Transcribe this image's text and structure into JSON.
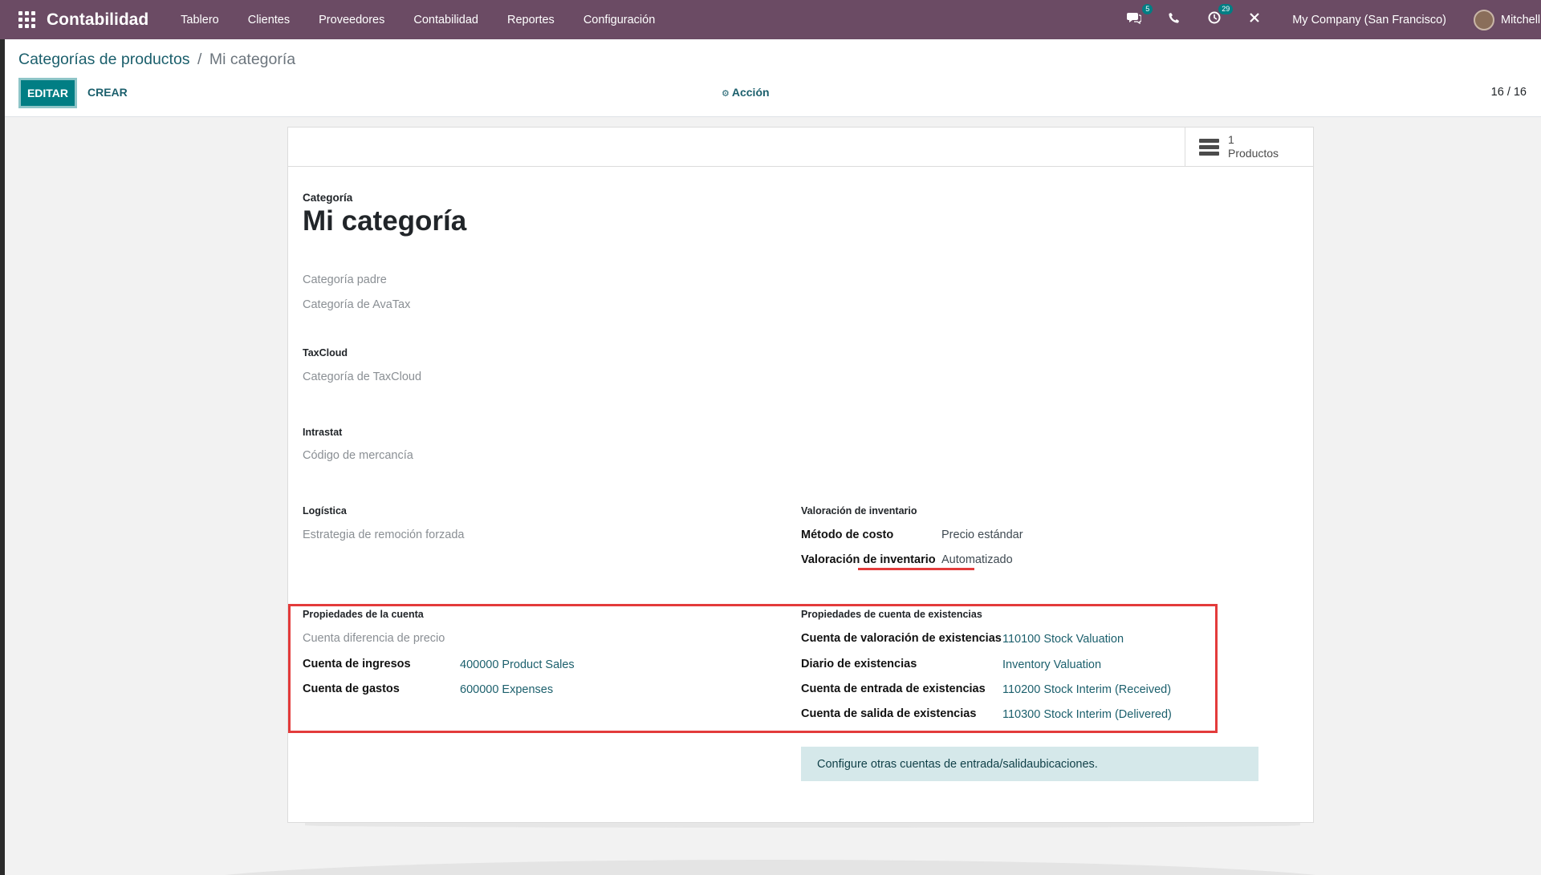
{
  "navbar": {
    "app_name": "Contabilidad",
    "menu": [
      "Tablero",
      "Clientes",
      "Proveedores",
      "Contabilidad",
      "Reportes",
      "Configuración"
    ],
    "messages_badge": "5",
    "activity_badge": "29",
    "company": "My Company (San Francisco)",
    "user": "Mitchell Admin"
  },
  "breadcrumb": {
    "parent": "Categorías de productos",
    "separator": "/",
    "current": "Mi categoría"
  },
  "toolbar": {
    "edit_label": "EDITAR",
    "create_label": "CREAR",
    "action_label": "Acción",
    "pager": "16 / 16"
  },
  "stat_button": {
    "count": "1",
    "label": "Productos"
  },
  "form": {
    "category_label": "Categoría",
    "name": "Mi categoría",
    "parent_category": "Categoría padre",
    "avatax_category": "Categoría de AvaTax",
    "taxcloud_title": "TaxCloud",
    "taxcloud_category": "Categoría de TaxCloud",
    "intrastat_title": "Intrastat",
    "commodity_code": "Código de mercancía",
    "logistics_title": "Logística",
    "removal_strategy": "Estrategia de remoción forzada",
    "valuation_title": "Valoración de inventario",
    "cost_method_label": "Método de costo",
    "cost_method_value": "Precio estándar",
    "inventory_valuation_label": "Valoración de inventario",
    "inventory_valuation_value": "Automatizado",
    "account_props_title": "Propiedades de la cuenta",
    "price_diff_account": "Cuenta diferencia de precio",
    "income_account_label": "Cuenta de ingresos",
    "income_account_value": "400000 Product Sales",
    "expense_account_label": "Cuenta de gastos",
    "expense_account_value": "600000 Expenses",
    "stock_props_title": "Propiedades de cuenta de existencias",
    "stock_valuation_account_label": "Cuenta de valoración de existencias",
    "stock_valuation_account_value": "110100 Stock Valuation",
    "stock_journal_label": "Diario de existencias",
    "stock_journal_value": "Inventory Valuation",
    "stock_input_account_label": "Cuenta de entrada de existencias",
    "stock_input_account_value": "110200 Stock Interim (Received)",
    "stock_output_account_label": "Cuenta de salida de existencias",
    "stock_output_account_value": "110300 Stock Interim (Delivered)",
    "alert_text": "Configure otras cuentas de entrada/salidaubicaciones."
  },
  "colors": {
    "navbar": "#6b4b64",
    "primary": "#017e84",
    "link": "#1b5f6c",
    "highlight": "#e33b3b",
    "alert_bg": "#d5e8ea"
  },
  "icons": [
    "apps-grid-icon",
    "chat-icon",
    "phone-icon",
    "activity-clock-icon",
    "close-icon",
    "gear-icon",
    "list-icon"
  ]
}
